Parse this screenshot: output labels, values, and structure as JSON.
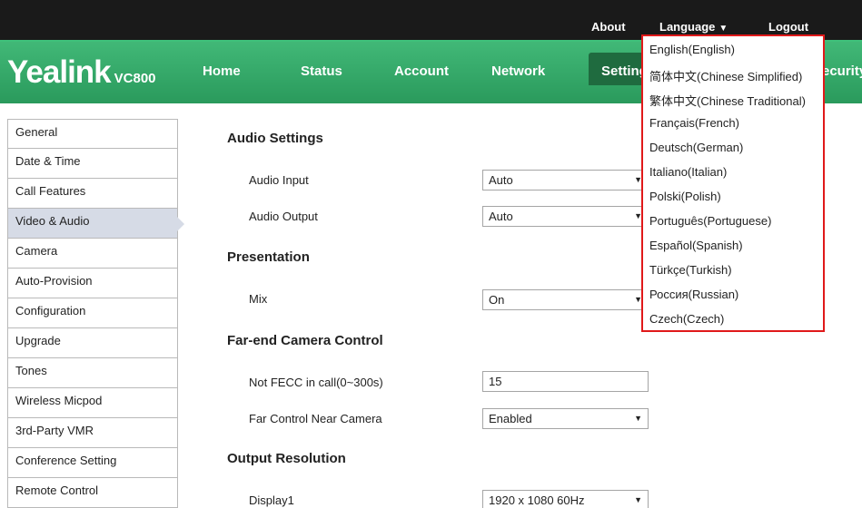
{
  "topbar": {
    "about": "About",
    "language": "Language",
    "logout": "Logout"
  },
  "brand": {
    "logo": "Yealink",
    "model": "VC800"
  },
  "nav": {
    "home": "Home",
    "status": "Status",
    "account": "Account",
    "network": "Network",
    "settings": "Setting",
    "security": "ecurity"
  },
  "sidebar": {
    "items": [
      {
        "label": "General"
      },
      {
        "label": "Date & Time"
      },
      {
        "label": "Call Features"
      },
      {
        "label": "Video & Audio",
        "active": true
      },
      {
        "label": "Camera"
      },
      {
        "label": "Auto-Provision"
      },
      {
        "label": "Configuration"
      },
      {
        "label": "Upgrade"
      },
      {
        "label": "Tones"
      },
      {
        "label": "Wireless Micpod"
      },
      {
        "label": "3rd-Party VMR"
      },
      {
        "label": "Conference Setting"
      },
      {
        "label": "Remote Control"
      }
    ]
  },
  "main": {
    "audio_settings": {
      "title": "Audio Settings",
      "audio_input_label": "Audio Input",
      "audio_input_value": "Auto",
      "audio_output_label": "Audio Output",
      "audio_output_value": "Auto"
    },
    "presentation": {
      "title": "Presentation",
      "mix_label": "Mix",
      "mix_value": "On"
    },
    "fecc": {
      "title": "Far-end Camera Control",
      "not_fecc_label": "Not FECC in call(0~300s)",
      "not_fecc_value": "15",
      "far_control_label": "Far Control Near Camera",
      "far_control_value": "Enabled"
    },
    "output_resolution": {
      "title": "Output Resolution",
      "display1_label": "Display1",
      "display1_value": "1920 x 1080 60Hz"
    }
  },
  "language_dropdown": {
    "options": [
      "English(English)",
      "简体中文(Chinese Simplified)",
      "繁体中文(Chinese Traditional)",
      "Français(French)",
      "Deutsch(German)",
      "Italiano(Italian)",
      "Polski(Polish)",
      "Português(Portuguese)",
      "Español(Spanish)",
      "Türkçe(Turkish)",
      "Россия(Russian)",
      "Czech(Czech)"
    ]
  },
  "colors": {
    "nav_green": "#2a9a5c",
    "active_tab": "#1f6b3f",
    "dropdown_border": "#e0191a",
    "sidebar_active": "#d6dbe6"
  }
}
